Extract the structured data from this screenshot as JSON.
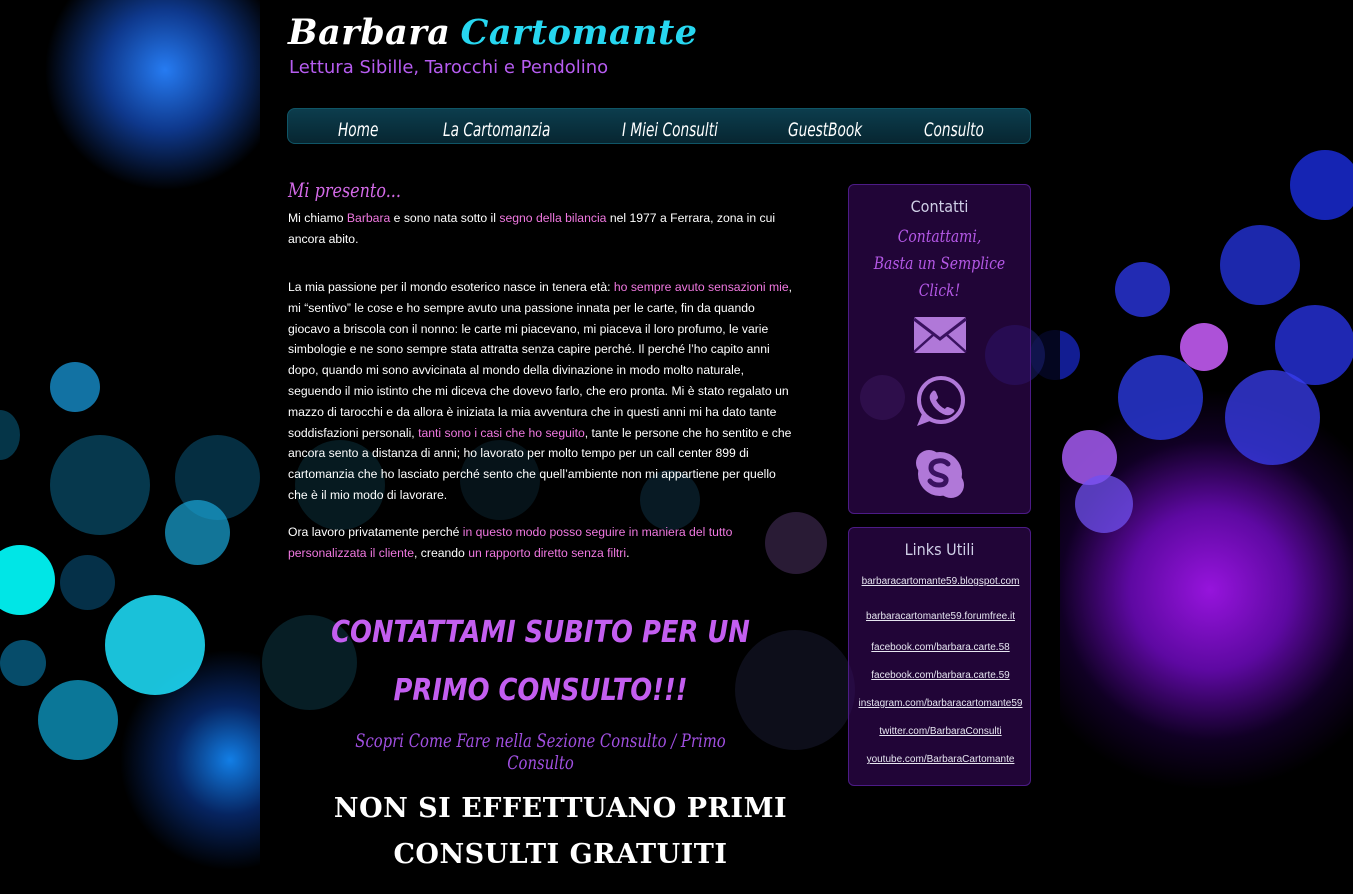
{
  "header": {
    "title_part1": "Barbara",
    "title_part2": "Cartomante",
    "subtitle": "Lettura Sibille, Tarocchi e Pendolino"
  },
  "nav": {
    "items": [
      {
        "label": "Home"
      },
      {
        "label": "La Cartomanzia"
      },
      {
        "label": "I Miei Consulti"
      },
      {
        "label": "GuestBook"
      },
      {
        "label": "Consulto"
      }
    ]
  },
  "main": {
    "heading": "Mi presento...",
    "p1": {
      "t1": "Mi chiamo ",
      "h1": "Barbara",
      "t2": " e sono nata sotto il ",
      "h2": "segno della bilancia",
      "t3": " nel 1977 a Ferrara, zona in cui ancora abito."
    },
    "p2": {
      "t1": "La mia passione per il mondo esoterico nasce in tenera età: ",
      "h1": "ho sempre avuto sensazioni mie",
      "t2": ", mi “sentivo” le cose e ho sempre avuto una passione innata per le carte, fin da quando giocavo a briscola con il nonno: le carte mi piacevano, mi piaceva il loro profumo, le varie simbologie e ne sono sempre stata attratta senza capire perché. Il perché l’ho capito anni dopo, quando mi sono avvicinata al mondo della divinazione in modo molto naturale, seguendo il mio istinto che mi diceva che dovevo farlo, che ero pronta. Mi è stato regalato un mazzo di tarocchi e da allora è iniziata la mia avventura che in questi anni mi ha dato tante soddisfazioni personali, ",
      "h2": "tanti sono i casi che ho seguito",
      "t3": ", tante le persone che ho sentito e che ancora sento a distanza di anni; ho lavorato per molto tempo per un call center 899 di cartomanzia che ho lasciato perché sento che quell’ambiente non mi appartiene per quello che è il mio modo di lavorare."
    },
    "p3": {
      "t1": "Ora lavoro privatamente perché ",
      "h1": "in questo modo posso seguire in maniera del tutto personalizzata il cliente",
      "t2": ", creando ",
      "h2": "un rapporto diretto senza filtri",
      "t3": "."
    },
    "cta": "CONTATTAMI SUBITO PER UN PRIMO CONSULTO!!!",
    "cta_sub": "Scopri Come Fare nella Sezione Consulto / Primo Consulto",
    "notice_line1": "NON SI EFFETTUANO PRIMI",
    "notice_line2": "CONSULTI GRATUITI"
  },
  "sidebar": {
    "contacts": {
      "title": "Contatti",
      "tagline_line1": "Contattami,",
      "tagline_line2": "Basta un Semplice Click!",
      "icons": [
        "mail-icon",
        "whatsapp-icon",
        "skype-icon"
      ]
    },
    "links": {
      "title": "Links Utili",
      "items": [
        "barbaracartomante59.blogspot.com",
        "barbaracartomante59.forumfree.it",
        "facebook.com/barbara.carte.58",
        "facebook.com/barbara.carte.59",
        "instagram.com/barbaracartomante59",
        "twitter.com/BarbaraConsulti",
        "youtube.com/BarbaraCartomante"
      ]
    }
  },
  "colors": {
    "title_accent": "#27d7f0",
    "subtitle": "#b65cf0",
    "highlight": "#f078e0",
    "cta": "#c35ef0"
  }
}
